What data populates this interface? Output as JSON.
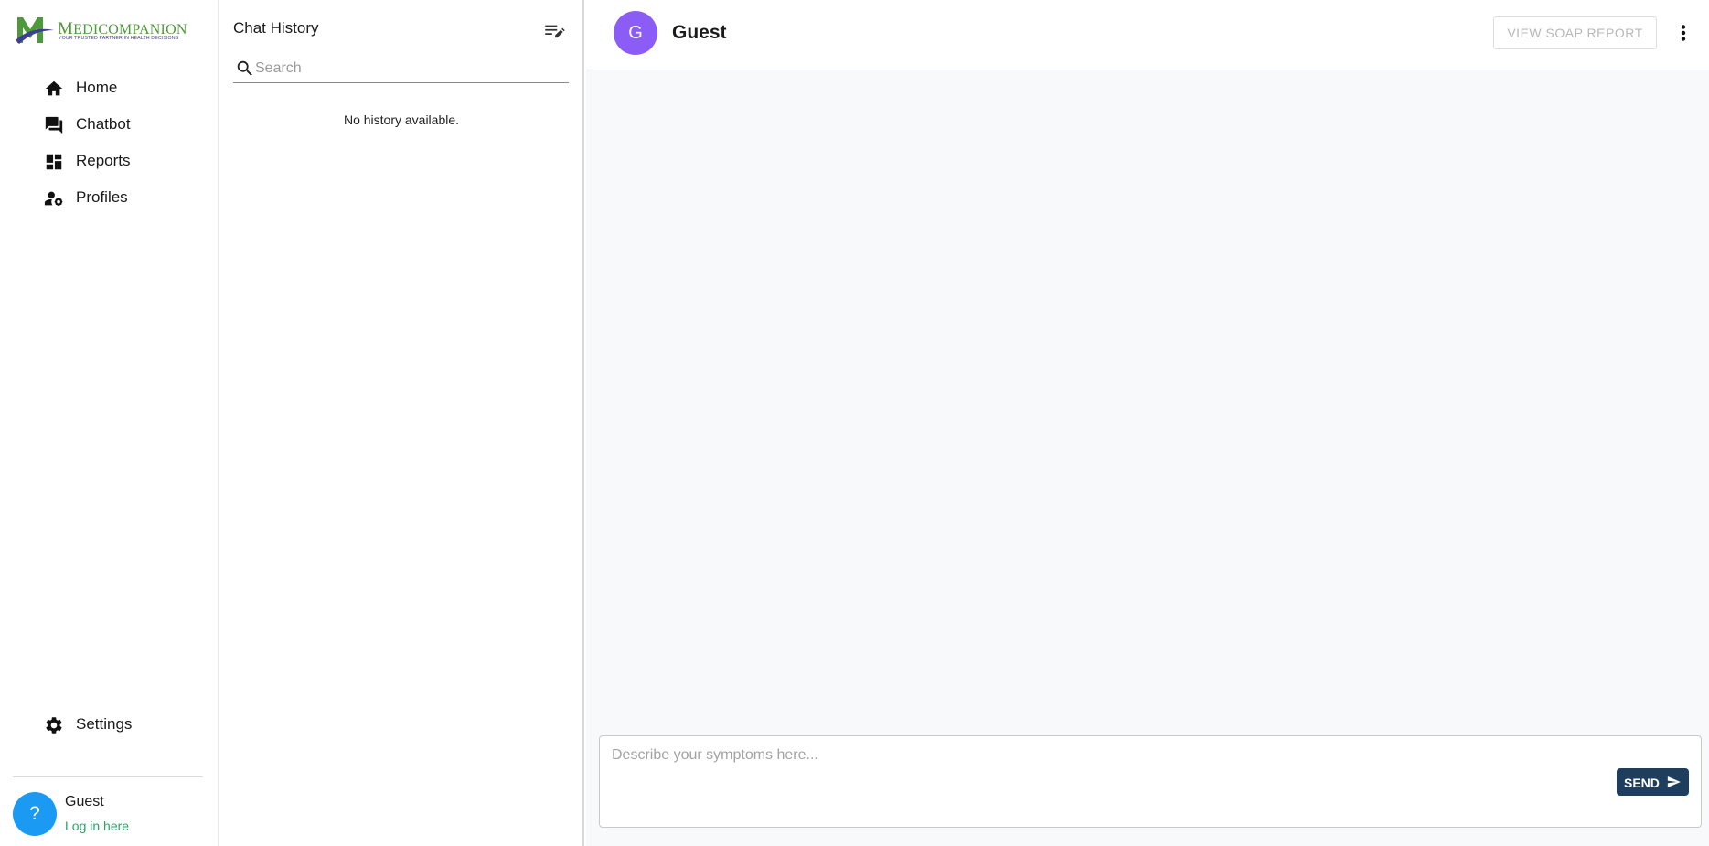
{
  "app": {
    "brand_name_initial": "M",
    "brand_name_rest": "EDICOMPANION",
    "brand_tagline": "YOUR TRUSTED PARTNER IN HEALTH DECISIONS",
    "colors": {
      "brand_green": "#4e9a3a",
      "brand_purple": "#3f3f8f",
      "accent_blue": "#1a9af2",
      "send_navy": "#1f3e5e",
      "avatar_purple": "#8b5cf6"
    }
  },
  "sidebar": {
    "items": [
      {
        "label": "Home",
        "icon": "home-icon"
      },
      {
        "label": "Chatbot",
        "icon": "chat-bubbles-icon"
      },
      {
        "label": "Reports",
        "icon": "dashboard-icon"
      },
      {
        "label": "Profiles",
        "icon": "manage-accounts-icon"
      }
    ],
    "settings_label": "Settings",
    "user": {
      "avatar_text": "?",
      "name": "Guest",
      "login_link": "Log in here"
    }
  },
  "history": {
    "title": "Chat History",
    "search_placeholder": "Search",
    "search_value": "",
    "empty_message": "No history available."
  },
  "chat": {
    "avatar_letter": "G",
    "name": "Guest",
    "soap_button": "VIEW SOAP REPORT",
    "input_placeholder": "Describe your symptoms here...",
    "input_value": "",
    "send_label": "SEND"
  }
}
